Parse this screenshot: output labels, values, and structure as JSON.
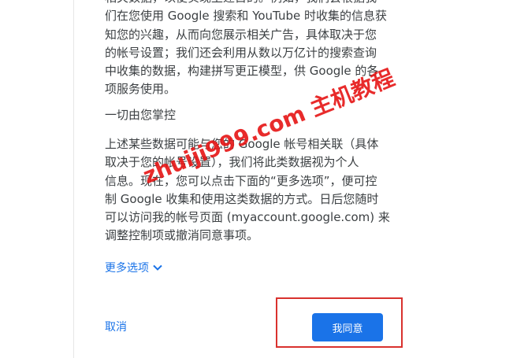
{
  "consent": {
    "intro_lines": [
      "相关数据，以便实现上述目的。例如，我们会根据我",
      "们在您使用 Google 搜索和 YouTube 时收集的信息获",
      "知您的兴趣，从而向您展示相关广告，具体取决于您",
      "的帐号设置；我们还会利用从数以万亿计的搜索查询",
      "中收集的数据，构建拼写更正模型，供 Google 的各",
      "项服务使用。"
    ],
    "control_heading": "一切由您掌控",
    "control_lines": [
      "上述某些数据可能与您的 Google 帐号相关联（具体",
      "取决于您的帐号设置），我们将此类数据视为个人",
      "信息。现在，您可以点击下面的“更多选项”，便可控",
      "制 Google 收集和使用这类数据的方式。日后您随时",
      "可以访问我的帐号页面 (myaccount.google.com) 来",
      "调整控制项或撤消同意事项。"
    ],
    "more_options_label": "更多选项",
    "cancel_label": "取消",
    "agree_label": "我同意"
  },
  "watermark_text": "zhuiji999.com 主机教程",
  "colors": {
    "link_blue": "#1a73e8",
    "button_blue": "#1a73e8",
    "text": "#3c4043",
    "highlight_red": "#d9322e"
  },
  "icons": {
    "more_options_icon": "chevron-down-icon"
  }
}
